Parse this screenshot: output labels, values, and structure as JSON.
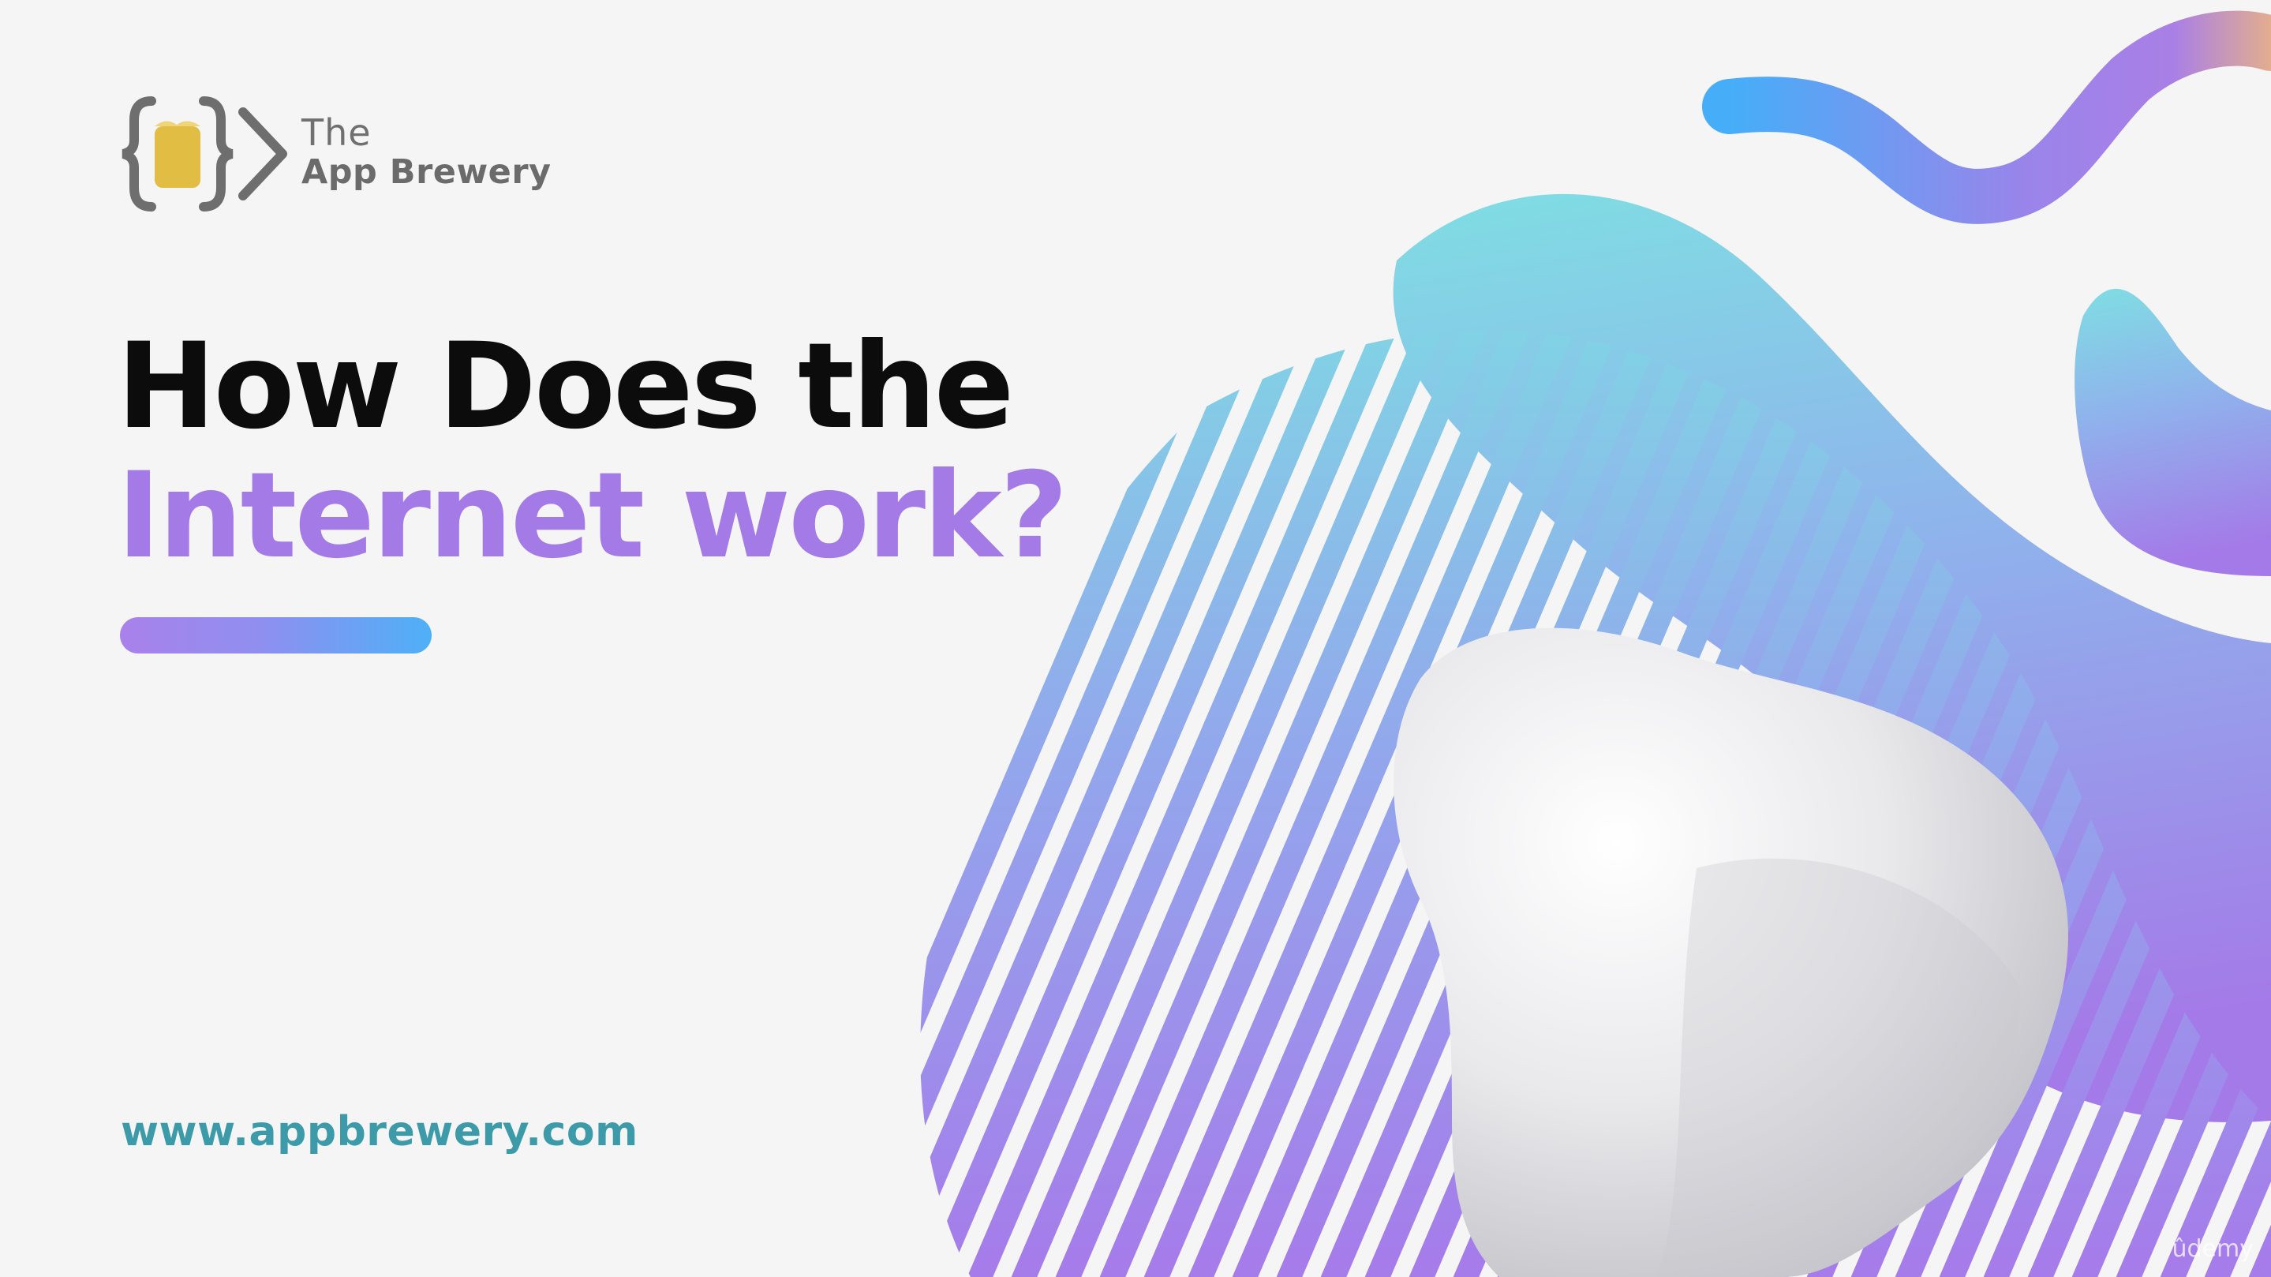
{
  "brand": {
    "the": "The",
    "name": "App Brewery"
  },
  "headline": {
    "line1": "How Does the",
    "line2": "Internet work?"
  },
  "website": "www.appbrewery.com",
  "watermark": "ûdemy",
  "colors": {
    "background": "#f5f5f5",
    "headline": "#0c0c0c",
    "headline_accent": "#a47ae6",
    "website": "#3d9aa8",
    "gradient_purple": "#a47ae6",
    "gradient_blue": "#4eb0f7",
    "gradient_cyan": "#7fdde3",
    "logo_gray": "#6b6b6b",
    "logo_yellow": "#e2bd44"
  },
  "icons": {
    "logo": "code-braces-beer-icon"
  }
}
